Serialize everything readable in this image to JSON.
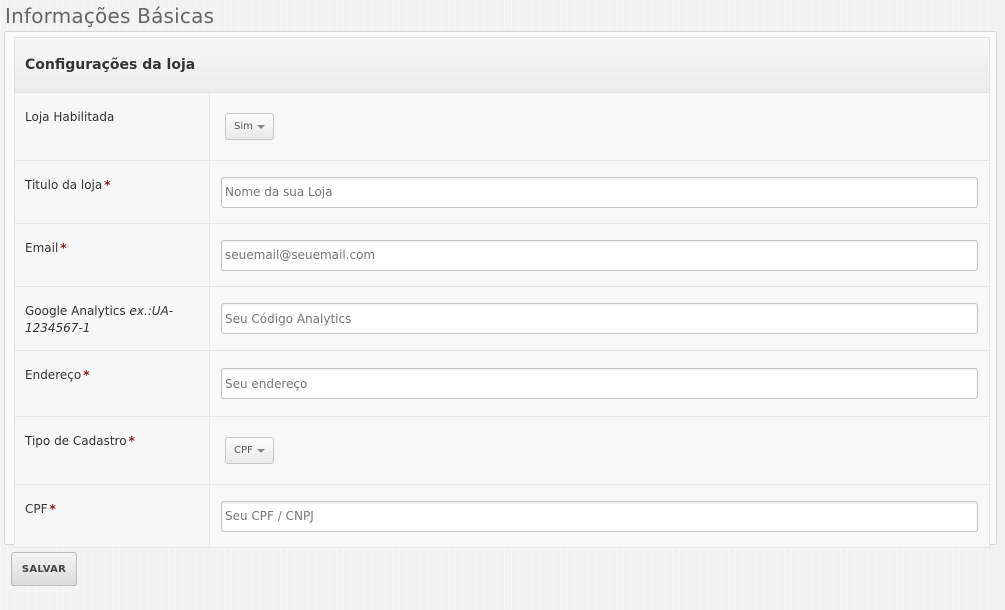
{
  "page": {
    "title": "Informações Básicas"
  },
  "panel": {
    "title": "Configurações da loja"
  },
  "fields": {
    "store_enabled": {
      "label": "Loja Habilitada",
      "value": "Sim"
    },
    "store_title": {
      "label": "Titulo da loja",
      "required": "*",
      "placeholder": "Nome da sua Loja",
      "value": ""
    },
    "email": {
      "label": "Email",
      "required": "*",
      "placeholder": "seuemail@seuemail.com",
      "value": ""
    },
    "analytics": {
      "label": "Google Analytics",
      "hint": "ex.:UA-1234567-1",
      "placeholder": "Seu Código Analytics",
      "value": ""
    },
    "address": {
      "label": "Endereço",
      "required": "*",
      "placeholder": "Seu endereço",
      "value": ""
    },
    "registration_type": {
      "label": "Tipo de Cadastro",
      "required": "*",
      "value": "CPF"
    },
    "cpf": {
      "label": "CPF",
      "required": "*",
      "placeholder": "Seu CPF / CNPJ",
      "value": ""
    }
  },
  "actions": {
    "save_label": "SALVAR"
  }
}
